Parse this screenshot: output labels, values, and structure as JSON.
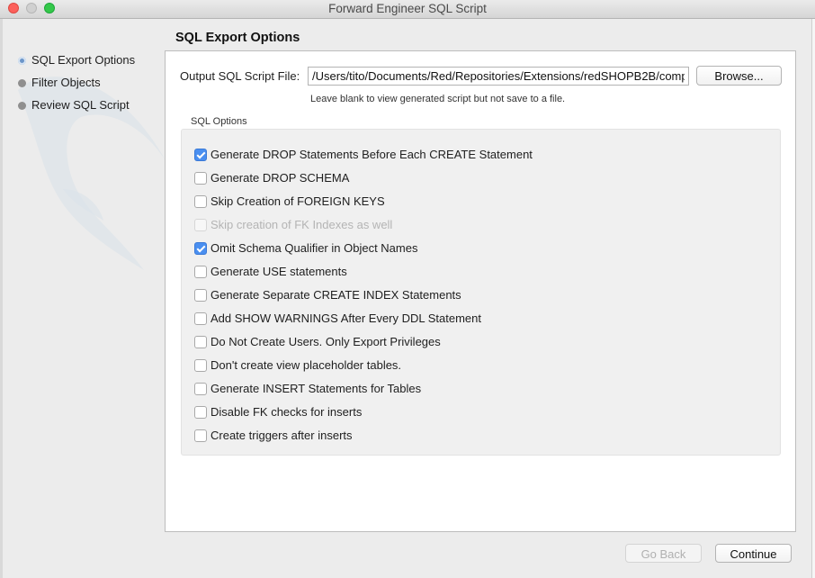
{
  "window": {
    "title": "Forward Engineer SQL Script"
  },
  "sidebar": {
    "steps": [
      {
        "label": "SQL Export Options",
        "active": true
      },
      {
        "label": "Filter Objects",
        "active": false
      },
      {
        "label": "Review SQL Script",
        "active": false
      }
    ]
  },
  "main": {
    "section_title": "SQL Export Options",
    "output": {
      "label": "Output SQL Script File:",
      "value": "/Users/tito/Documents/Red/Repositories/Extensions/redSHOPB2B/comp",
      "browse_label": "Browse...",
      "hint": "Leave blank to view generated script but not save to a file."
    },
    "sql_options": {
      "label": "SQL Options",
      "items": [
        {
          "label": "Generate DROP Statements Before Each CREATE Statement",
          "checked": true,
          "enabled": true
        },
        {
          "label": "Generate DROP SCHEMA",
          "checked": false,
          "enabled": true
        },
        {
          "label": "Skip Creation of FOREIGN KEYS",
          "checked": false,
          "enabled": true
        },
        {
          "label": "Skip creation of FK Indexes as well",
          "checked": false,
          "enabled": false
        },
        {
          "label": "Omit Schema Qualifier in Object Names",
          "checked": true,
          "enabled": true
        },
        {
          "label": "Generate USE statements",
          "checked": false,
          "enabled": true
        },
        {
          "label": "Generate Separate CREATE INDEX Statements",
          "checked": false,
          "enabled": true
        },
        {
          "label": "Add SHOW WARNINGS After Every DDL Statement",
          "checked": false,
          "enabled": true
        },
        {
          "label": "Do Not Create Users. Only Export Privileges",
          "checked": false,
          "enabled": true
        },
        {
          "label": "Don't create view placeholder tables.",
          "checked": false,
          "enabled": true
        },
        {
          "label": "Generate INSERT Statements for Tables",
          "checked": false,
          "enabled": true
        },
        {
          "label": "Disable FK checks for inserts",
          "checked": false,
          "enabled": true
        },
        {
          "label": "Create triggers after inserts",
          "checked": false,
          "enabled": true
        }
      ]
    }
  },
  "footer": {
    "back_label": "Go Back",
    "back_enabled": false,
    "continue_label": "Continue"
  },
  "colors": {
    "checkbox_checked": "#4a8ff0",
    "active_step_dot": "#6c96c9"
  }
}
